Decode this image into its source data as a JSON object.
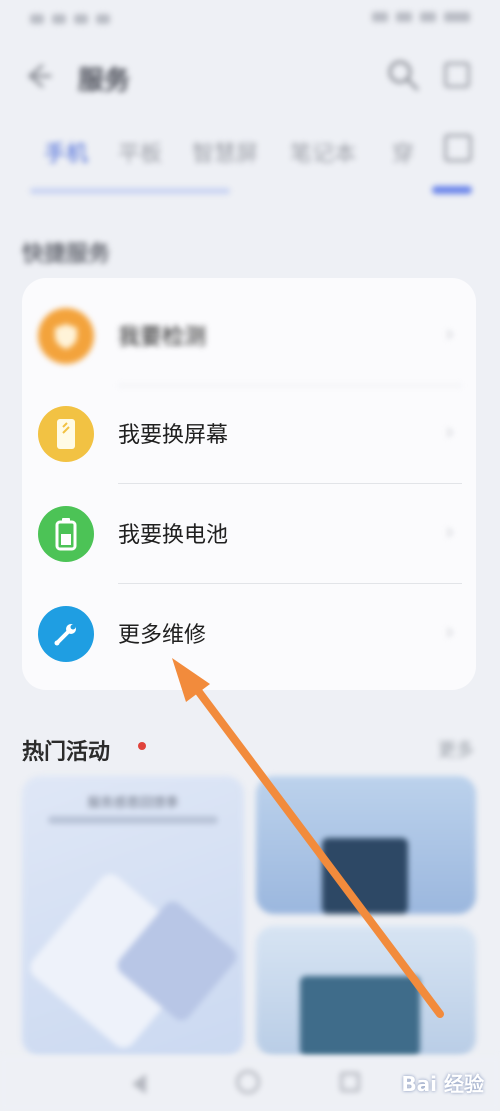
{
  "header": {
    "back_icon": "back-arrow-icon",
    "title": "服务",
    "search_icon": "search-icon",
    "more_icon": "more-icon"
  },
  "tabs": [
    {
      "label": "手机",
      "active": true
    },
    {
      "label": "平板",
      "active": false
    },
    {
      "label": "智慧屏",
      "active": false
    },
    {
      "label": "笔记本",
      "active": false
    },
    {
      "label": "穿",
      "active": false
    }
  ],
  "repair_section": {
    "title": "快捷服务",
    "items": [
      {
        "label": "我要检测",
        "icon": "shield-icon",
        "color": "#f3a33c"
      },
      {
        "label": "我要换屏幕",
        "icon": "phone-screen-icon",
        "color": "#f2c243"
      },
      {
        "label": "我要换电池",
        "icon": "battery-icon",
        "color": "#4cc356"
      },
      {
        "label": "更多维修",
        "icon": "wrench-icon",
        "color": "#1f9ee2"
      }
    ]
  },
  "hot": {
    "title": "热门活动",
    "more": "更多",
    "promo_left_title": "服务感恩回馈季"
  },
  "watermark": "Bai 经验",
  "colors": {
    "accent": "#4b6bd8",
    "annotation_arrow": "#f28b3c"
  }
}
